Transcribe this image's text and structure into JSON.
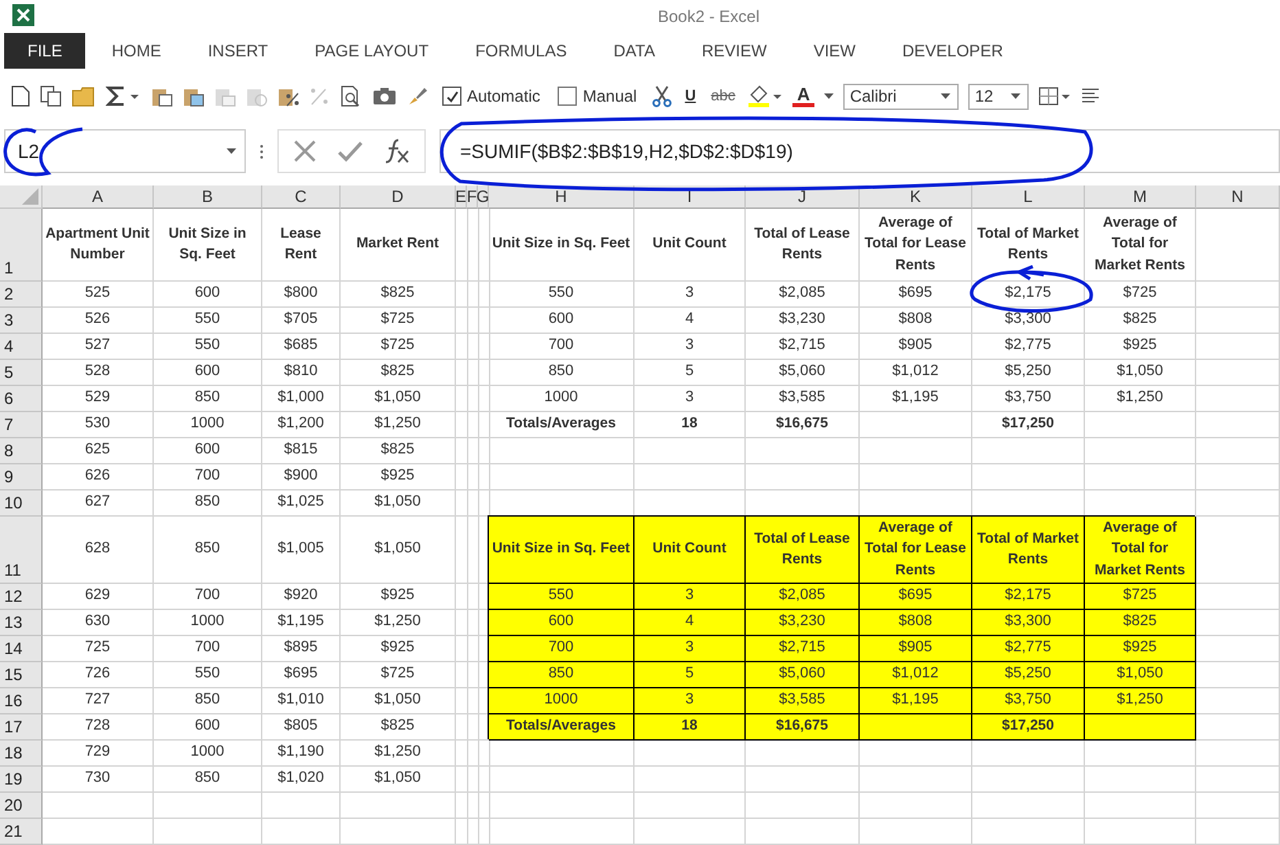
{
  "window": {
    "title": "Book2 - Excel"
  },
  "ribbon_tabs": [
    {
      "label": "FILE",
      "kind": "file"
    },
    {
      "label": "HOME",
      "kind": "tab"
    },
    {
      "label": "INSERT",
      "kind": "tab"
    },
    {
      "label": "PAGE LAYOUT",
      "kind": "tab"
    },
    {
      "label": "FORMULAS",
      "kind": "tab"
    },
    {
      "label": "DATA",
      "kind": "tab"
    },
    {
      "label": "REVIEW",
      "kind": "tab"
    },
    {
      "label": "VIEW",
      "kind": "tab"
    },
    {
      "label": "DEVELOPER",
      "kind": "tab"
    }
  ],
  "toolbar": {
    "checkboxes": [
      {
        "label": "Automatic",
        "checked": true
      },
      {
        "label": "Manual",
        "checked": false
      }
    ],
    "format_buttons": [
      {
        "label": "U",
        "kind": "underline"
      },
      {
        "label": "abc",
        "kind": "strikethrough"
      }
    ],
    "font_color_button": "A",
    "font": "Calibri",
    "font_size": "12"
  },
  "formula_bar": {
    "name_box": "L2",
    "formula": "=SUMIF($B$2:$B$19,H2,$D$2:$D$19)"
  },
  "sheet": {
    "columns": [
      "A",
      "B",
      "C",
      "D",
      "E",
      "F",
      "G",
      "H",
      "I",
      "J",
      "K",
      "L",
      "M",
      "N"
    ],
    "row_numbers": [
      "1",
      "2",
      "3",
      "4",
      "5",
      "6",
      "7",
      "8",
      "9",
      "10",
      "11",
      "12",
      "13",
      "14",
      "15",
      "16",
      "17",
      "18",
      "19",
      "20",
      "21"
    ],
    "data_table": {
      "headers": [
        "Apartment Unit Number",
        "Unit Size in Sq. Feet",
        "Lease Rent",
        "Market Rent"
      ],
      "rows": [
        [
          "525",
          "600",
          "$800",
          "$825"
        ],
        [
          "526",
          "550",
          "$705",
          "$725"
        ],
        [
          "527",
          "550",
          "$685",
          "$725"
        ],
        [
          "528",
          "600",
          "$810",
          "$825"
        ],
        [
          "529",
          "850",
          "$1,000",
          "$1,050"
        ],
        [
          "530",
          "1000",
          "$1,200",
          "$1,250"
        ],
        [
          "625",
          "600",
          "$815",
          "$825"
        ],
        [
          "626",
          "700",
          "$900",
          "$925"
        ],
        [
          "627",
          "850",
          "$1,025",
          "$1,050"
        ],
        [
          "628",
          "850",
          "$1,005",
          "$1,050"
        ],
        [
          "629",
          "700",
          "$920",
          "$925"
        ],
        [
          "630",
          "1000",
          "$1,195",
          "$1,250"
        ],
        [
          "725",
          "700",
          "$895",
          "$925"
        ],
        [
          "726",
          "550",
          "$695",
          "$725"
        ],
        [
          "727",
          "850",
          "$1,010",
          "$1,050"
        ],
        [
          "728",
          "600",
          "$805",
          "$825"
        ],
        [
          "729",
          "1000",
          "$1,190",
          "$1,250"
        ],
        [
          "730",
          "850",
          "$1,020",
          "$1,050"
        ]
      ]
    },
    "summary_tables": [
      {
        "highlighted": false,
        "headers": [
          "Unit Size in Sq. Feet",
          "Unit Count",
          "Total of Lease Rents",
          "Average of Total for Lease Rents",
          "Total of Market Rents",
          "Average of Total for Market Rents"
        ],
        "rows": [
          [
            "550",
            "3",
            "$2,085",
            "$695",
            "$2,175",
            "$725"
          ],
          [
            "600",
            "4",
            "$3,230",
            "$808",
            "$3,300",
            "$825"
          ],
          [
            "700",
            "3",
            "$2,715",
            "$905",
            "$2,775",
            "$925"
          ],
          [
            "850",
            "5",
            "$5,060",
            "$1,012",
            "$5,250",
            "$1,050"
          ],
          [
            "1000",
            "3",
            "$3,585",
            "$1,195",
            "$3,750",
            "$1,250"
          ]
        ],
        "totals": {
          "label": "Totals/Averages",
          "unit_count": "18",
          "total_lease_rents": "$16,675",
          "total_market_rents": "$17,250"
        }
      },
      {
        "highlighted": true,
        "headers": [
          "Unit Size in Sq. Feet",
          "Unit Count",
          "Total of Lease Rents",
          "Average of Total for Lease Rents",
          "Total of Market Rents",
          "Average of Total for Market Rents"
        ],
        "rows": [
          [
            "550",
            "3",
            "$2,085",
            "$695",
            "$2,175",
            "$725"
          ],
          [
            "600",
            "4",
            "$3,230",
            "$808",
            "$3,300",
            "$825"
          ],
          [
            "700",
            "3",
            "$2,715",
            "$905",
            "$2,775",
            "$925"
          ],
          [
            "850",
            "5",
            "$5,060",
            "$1,012",
            "$5,250",
            "$1,050"
          ],
          [
            "1000",
            "3",
            "$3,585",
            "$1,195",
            "$3,750",
            "$1,250"
          ]
        ],
        "totals": {
          "label": "Totals/Averages",
          "unit_count": "18",
          "total_lease_rents": "$16,675",
          "total_market_rents": "$17,250"
        }
      }
    ]
  }
}
